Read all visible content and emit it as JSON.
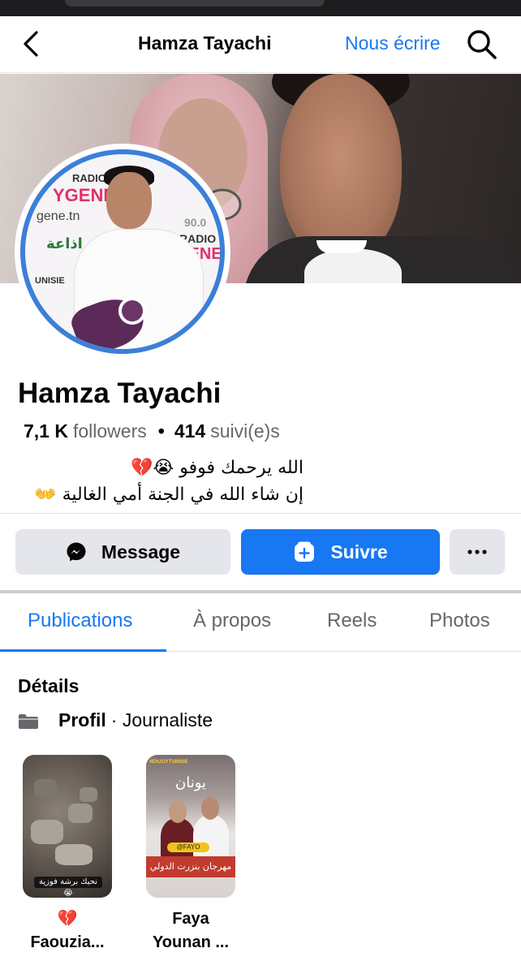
{
  "header": {
    "title": "Hamza Tayachi",
    "write_link": "Nous écrire"
  },
  "profile": {
    "name": "Hamza Tayachi",
    "followers_count": "7,1 K",
    "followers_label": "followers",
    "separator": "•",
    "following_count": "414",
    "following_label": "suivi(e)s",
    "bio_line1": "الله يرحمك فوفو 😭💔",
    "bio_line2": "إن شاء الله في الجنة أمي الغالية 👐"
  },
  "avatar_overlay_text": {
    "radio_top": "RADIO",
    "gene": "YGENE",
    "url": "gene.tn",
    "idaa": "اذاعة",
    "radio_bottom": "RADIO",
    "gene_bottom": "GENE",
    "tunisie": "UNISIE",
    "digits": "90.0"
  },
  "actions": {
    "message_label": "Message",
    "follow_label": "Suivre",
    "more_label": "···"
  },
  "tabs": [
    {
      "label": "Publications",
      "active": true
    },
    {
      "label": "À propos",
      "active": false
    },
    {
      "label": "Reels",
      "active": false
    },
    {
      "label": "Photos",
      "active": false
    }
  ],
  "details": {
    "title": "Détails",
    "profile_label": "Profil",
    "profile_type": "· Journaliste"
  },
  "highlights": [
    {
      "title_line1": "💔",
      "title_line2": "Faouzia...",
      "caption": "نحبك برشة فوزية 😭"
    },
    {
      "title_line1": "Faya",
      "title_line2": "Younan ...",
      "band_text": "مهرجان بنزرت الدولي",
      "heading": "يونان",
      "hashtag": "#ENJOYTUNISIE",
      "tag": "@FAYO"
    }
  ],
  "colors": {
    "accent": "#1877f2",
    "avatar_ring": "#3b7fd9",
    "button_grey": "#e4e6eb",
    "muted_text": "#65676b"
  },
  "icons": {
    "back": "chevron-left-icon",
    "search": "search-icon",
    "messenger": "messenger-icon",
    "follow": "add-friend-icon",
    "more": "more-dots-icon",
    "folder": "folder-icon"
  }
}
